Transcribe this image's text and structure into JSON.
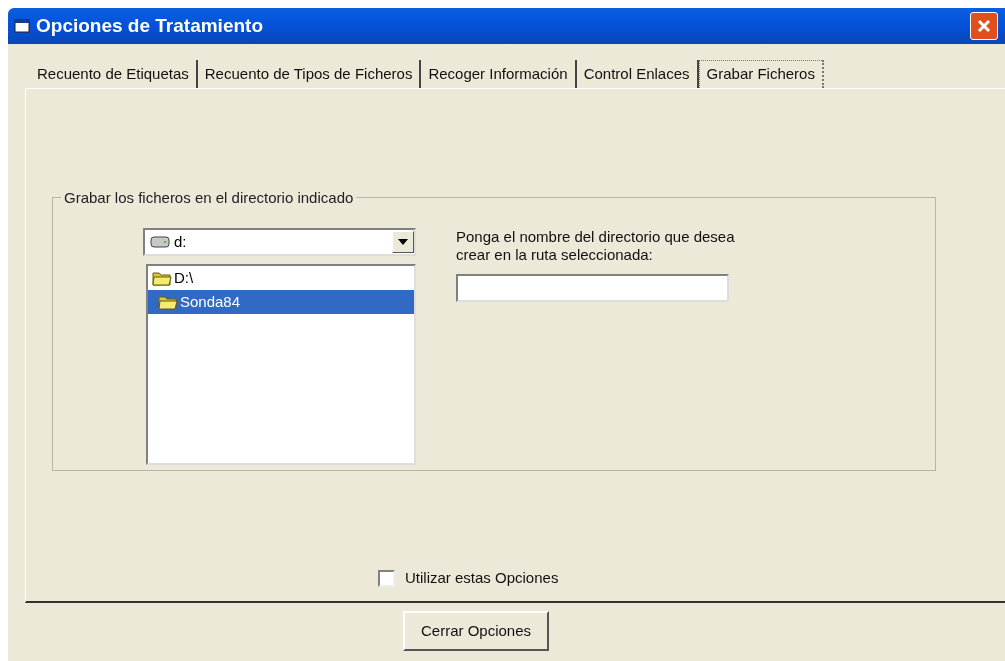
{
  "window": {
    "title": "Opciones de Tratamiento"
  },
  "tabs": [
    {
      "label": "Recuento de Etiquetas",
      "selected": false
    },
    {
      "label": "Recuento de Tipos de Ficheros",
      "selected": false
    },
    {
      "label": "Recoger Información",
      "selected": false
    },
    {
      "label": "Control Enlaces",
      "selected": false
    },
    {
      "label": "Grabar Ficheros",
      "selected": true
    }
  ],
  "group": {
    "title": "Grabar los ficheros en el directorio indicado",
    "drive_combo": {
      "value": "d:"
    },
    "folder_tree": [
      {
        "label": "D:\\",
        "selected": false,
        "children": [
          {
            "label": "Sonda84",
            "selected": true
          }
        ]
      }
    ],
    "directory_label": "Ponga el nombre del directorio que desea crear en la ruta seleccionada:"
  },
  "checkbox": {
    "label": "Utilizar estas Opciones",
    "checked": false
  },
  "buttons": [
    "Cerrar Opciones"
  ]
}
